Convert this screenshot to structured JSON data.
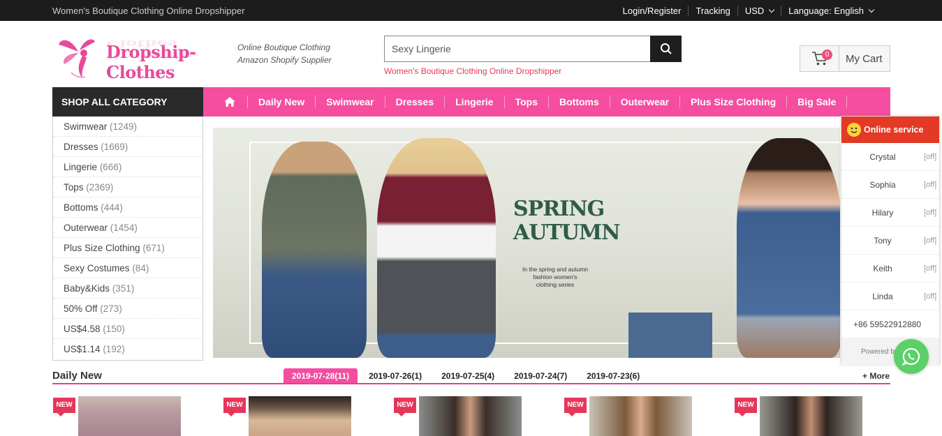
{
  "topbar": {
    "tagline": "Women's Boutique Clothing Online Dropshipper",
    "login": "Login/Register",
    "tracking": "Tracking",
    "currency": "USD",
    "language": "Language: English"
  },
  "header": {
    "logo_text": "Dropship-Clothes",
    "slogan_line1": "Online Boutique Clothing",
    "slogan_line2": "Amazon Shopify Supplier",
    "search_value": "Sexy Lingerie",
    "hot_keyword": "Women's Boutique Clothing Online Dropshipper",
    "cart_count": "0",
    "cart_label": "My Cart"
  },
  "nav": {
    "shop_all": "SHOP ALL CATEGORY",
    "items": [
      "Daily New",
      "Swimwear",
      "Dresses",
      "Lingerie",
      "Tops",
      "Bottoms",
      "Outerwear",
      "Plus Size Clothing",
      "Big Sale"
    ]
  },
  "categories": [
    {
      "name": "Swimwear",
      "count": "(1249)"
    },
    {
      "name": "Dresses",
      "count": "(1669)"
    },
    {
      "name": "Lingerie",
      "count": "(666)"
    },
    {
      "name": "Tops",
      "count": "(2369)"
    },
    {
      "name": "Bottoms",
      "count": "(444)"
    },
    {
      "name": "Outerwear",
      "count": "(1454)"
    },
    {
      "name": "Plus Size Clothing",
      "count": "(671)"
    },
    {
      "name": "Sexy Costumes",
      "count": "(84)"
    },
    {
      "name": "Baby&Kids",
      "count": "(351)"
    },
    {
      "name": "50% Off",
      "count": "(273)"
    },
    {
      "name": "US$4.58",
      "count": "(150)"
    },
    {
      "name": "US$1.14",
      "count": "(192)"
    }
  ],
  "banner": {
    "title_line1": "SPRING",
    "title_line2": "AUTUMN",
    "subtitle_line1": "In the spring and autumn",
    "subtitle_line2": "fashion women's",
    "subtitle_line3": "clothing series"
  },
  "service": {
    "title": "Online service",
    "agents": [
      {
        "name": "Crystal",
        "status": "[off]"
      },
      {
        "name": "Sophia",
        "status": "[off]"
      },
      {
        "name": "Hilary",
        "status": "[off]"
      },
      {
        "name": "Tony",
        "status": "[off]"
      },
      {
        "name": "Keith",
        "status": "[off]"
      },
      {
        "name": "Linda",
        "status": "[off]"
      }
    ],
    "phone": "+86 59522912880",
    "powered": "Powered by Sinfi"
  },
  "daily_new": {
    "title": "Daily New",
    "dates": [
      "2019-07-28(11)",
      "2019-07-26(1)",
      "2019-07-25(4)",
      "2019-07-24(7)",
      "2019-07-23(6)"
    ],
    "more": "+ More",
    "new_tag": "NEW"
  },
  "colors": {
    "accent_pink": "#f54d9f",
    "dark": "#1c1c1c",
    "service_red": "#e23a25",
    "whatsapp_green": "#5bd066"
  }
}
